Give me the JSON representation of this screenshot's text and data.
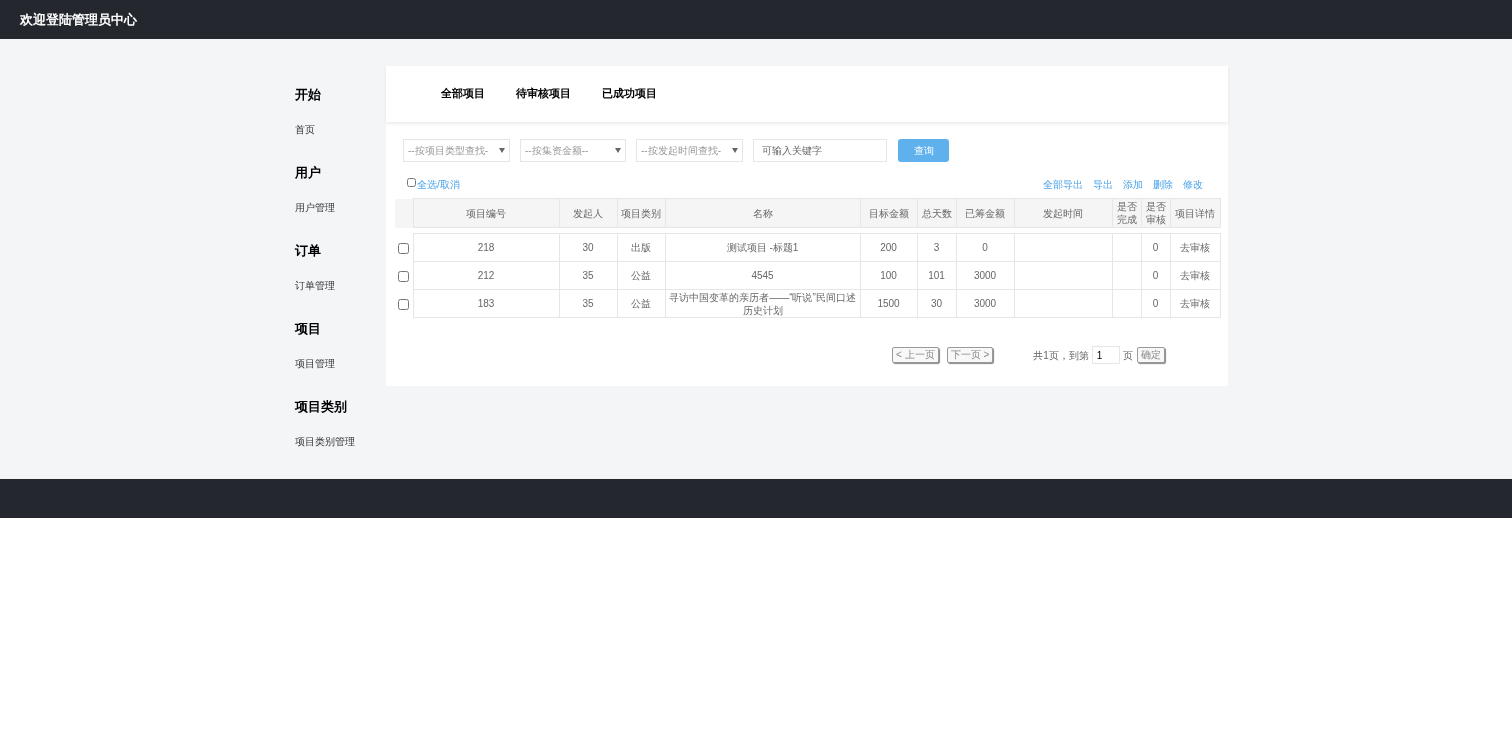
{
  "header": {
    "title": "欢迎登陆管理员中心"
  },
  "sidebar": {
    "sections": [
      {
        "heading": "开始",
        "items": [
          {
            "label": "首页",
            "selected": false
          }
        ]
      },
      {
        "heading": "用户",
        "items": [
          {
            "label": "用户管理",
            "selected": false
          }
        ]
      },
      {
        "heading": "订单",
        "items": [
          {
            "label": "订单管理",
            "selected": false
          }
        ]
      },
      {
        "heading": "项目",
        "items": [
          {
            "label": "项目管理",
            "selected": false
          }
        ]
      },
      {
        "heading": "项目类别",
        "items": [
          {
            "label": "项目类别管理",
            "selected": false
          }
        ]
      }
    ]
  },
  "tabs": [
    {
      "label": "全部项目",
      "selected": false
    },
    {
      "label": "待审核项目",
      "selected": false
    },
    {
      "label": "已成功项目",
      "selected": false
    }
  ],
  "filters": {
    "selects": [
      "--按项目类型查找-",
      "--按集资金额--",
      "--按发起时间查找-"
    ],
    "keyword": {
      "placeholder": "可输入关键字"
    },
    "search_button": "查询"
  },
  "select_all": {
    "label": "全选/取消",
    "checked": false
  },
  "actions": [
    "全部导出",
    "导出",
    "添加",
    "删除",
    "修改"
  ],
  "table": {
    "columns": [
      "项目编号",
      "发起人",
      "项目类别",
      "名称",
      "目标金额",
      "总天数",
      "已筹金额",
      "发起时间",
      "是否完成",
      "是否审核",
      "项目详情"
    ],
    "rows": [
      {
        "checked": false,
        "id": "218",
        "initiator": "30",
        "category": "出版",
        "name": "测试项目 -标题1",
        "target": "200",
        "days": "3",
        "raised": "0",
        "audited": "0",
        "action": "去审核"
      },
      {
        "checked": false,
        "id": "212",
        "initiator": "35",
        "category": "公益",
        "name": "4545",
        "target": "100",
        "days": "101",
        "raised": "3000",
        "audited": "0",
        "action": "去审核"
      },
      {
        "checked": false,
        "id": "183",
        "initiator": "35",
        "category": "公益",
        "name": "寻访中国变革的亲历者——“听说”民间口述历史计划",
        "target": "1500",
        "days": "30",
        "raised": "3000",
        "audited": "0",
        "action": "去审核"
      }
    ]
  },
  "pagination": {
    "prev": "< 上一页",
    "next": "下一页 >",
    "total": "共1页，到第",
    "page": "1",
    "page_suffix": "页",
    "confirm": "确定"
  }
}
